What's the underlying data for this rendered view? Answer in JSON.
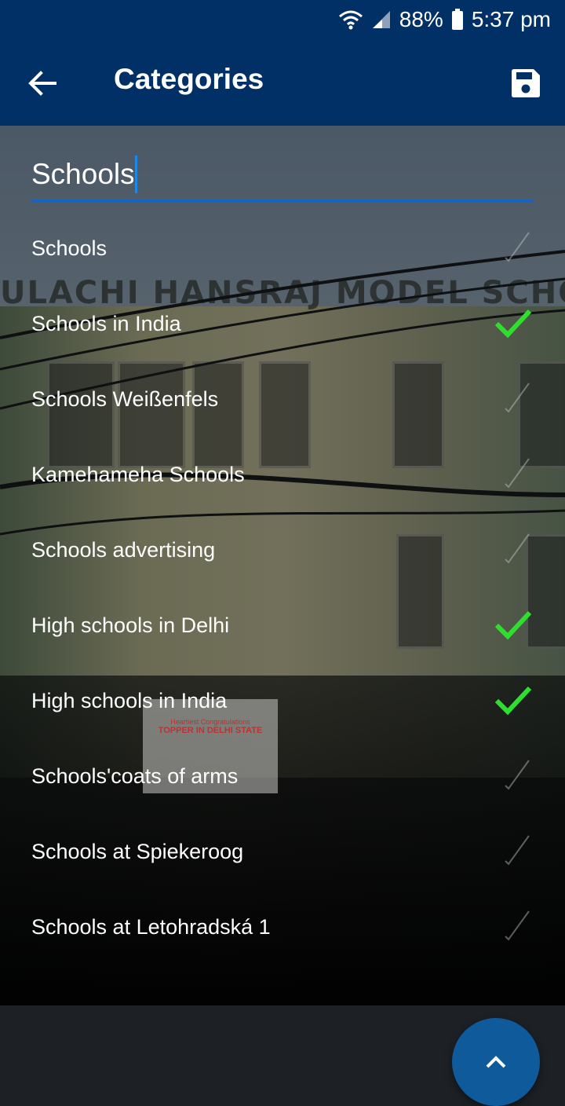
{
  "status_bar": {
    "battery": "88%",
    "time": "5:37 pm",
    "icons": [
      "wifi-icon",
      "signal-icon",
      "battery-icon"
    ]
  },
  "app_bar": {
    "title": "Categories",
    "back_icon": "arrow-back-icon",
    "save_icon": "save-disk-icon"
  },
  "search": {
    "value": "Schools"
  },
  "categories": [
    {
      "label": "Schools",
      "checked": false
    },
    {
      "label": "Schools in India",
      "checked": true
    },
    {
      "label": "Schools Weißenfels",
      "checked": false
    },
    {
      "label": "Kamehameha Schools",
      "checked": false
    },
    {
      "label": "Schools advertising",
      "checked": false
    },
    {
      "label": "High schools in Delhi",
      "checked": true
    },
    {
      "label": "High schools in India",
      "checked": true
    },
    {
      "label": "Schools'coats of arms",
      "checked": false
    },
    {
      "label": "Schools at Spiekeroog",
      "checked": false
    },
    {
      "label": "Schools at Letohradská 1",
      "checked": false
    }
  ],
  "fab": {
    "icon": "chevron-up-icon"
  },
  "background_photo": {
    "sign": "ULACHI HANSRAJ MODEL SCHOOL",
    "poster_line_1": "Heartiest Congratulations",
    "poster_line_2": "TOPPER IN DELHI STATE"
  },
  "colors": {
    "app_bar": "#003066",
    "accent": "#1565c0",
    "check_on": "#2ee02e",
    "fab": "#0f5a9a"
  }
}
